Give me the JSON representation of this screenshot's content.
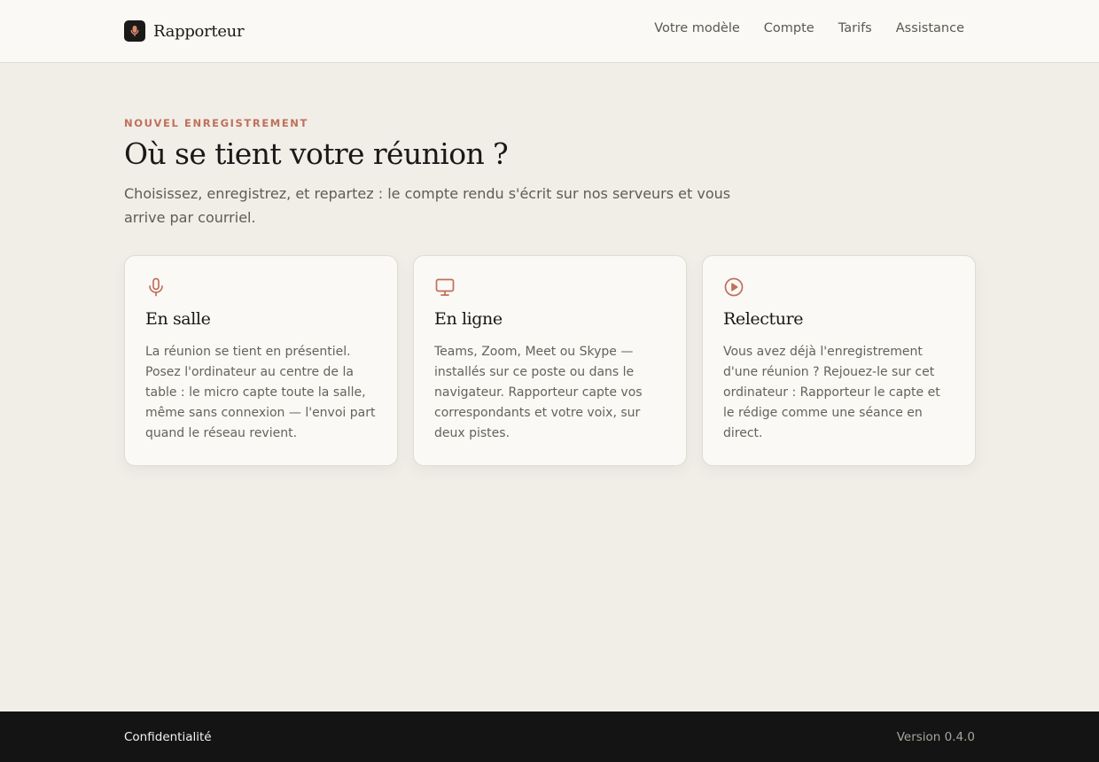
{
  "brand": {
    "name": "Rapporteur",
    "logo_icon": "microphone-icon"
  },
  "nav": {
    "items": [
      {
        "label": "Votre modèle"
      },
      {
        "label": "Compte"
      },
      {
        "label": "Tarifs"
      },
      {
        "label": "Assistance"
      }
    ]
  },
  "hero": {
    "eyebrow": "NOUVEL ENREGISTREMENT",
    "title": "Où se tient votre réunion ?",
    "subtitle": "Choisissez, enregistrez, et repartez : le compte rendu s'écrit sur nos serveurs et vous arrive par courriel."
  },
  "options": [
    {
      "icon": "microphone-icon",
      "title": "En salle",
      "description": "La réunion se tient en présentiel. Posez l'ordinateur au centre de la table : le micro capte toute la salle, même sans connexion — l'envoi part quand le réseau revient."
    },
    {
      "icon": "monitor-icon",
      "title": "En ligne",
      "description": "Teams, Zoom, Meet ou Skype — installés sur ce poste ou dans le navigateur. Rapporteur capte vos correspondants et votre voix, sur deux pistes."
    },
    {
      "icon": "play-circle-icon",
      "title": "Relecture",
      "description": "Vous avez déjà l'enregistrement d'une réunion ? Rejouez-le sur cet ordinateur : Rapporteur le capte et le rédige comme une séance en direct."
    }
  ],
  "footer": {
    "privacy_label": "Confidentialité",
    "version": "Version 0.4.0"
  },
  "colors": {
    "accent": "#c0705a",
    "background": "#f1eee8",
    "surface": "#faf9f6",
    "footer": "#141414"
  }
}
